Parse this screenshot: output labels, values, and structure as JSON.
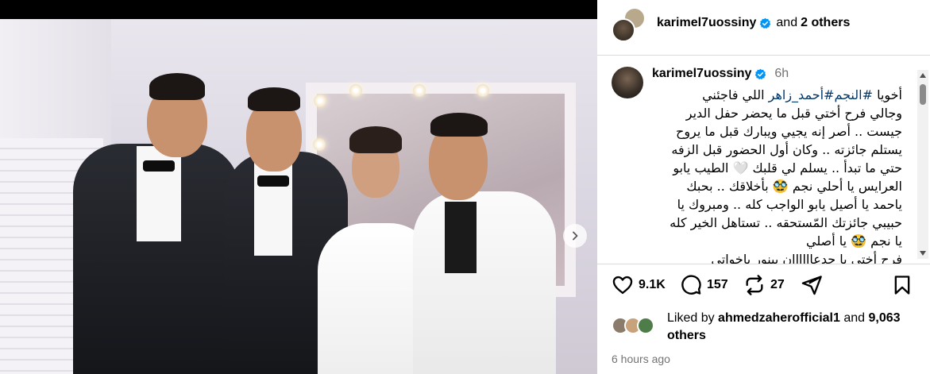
{
  "header": {
    "username": "karimel7uossiny",
    "and_text": "and",
    "others_text": "2 others"
  },
  "caption": {
    "username": "karimel7uossiny",
    "time": "6h",
    "hashtag1": "#النجم",
    "hashtag2": "#أحمد_زاهر",
    "lines": [
      "وجالي فرح أختي قبل ما يحضر حفل الدير",
      "جيست .. أصر إنه يجيي ويبارك قبل ما يروح",
      "يستلم جائزته .. وكان أول الحضور قبل الزفه",
      "حتي ما تبدأ .. يسلم لي قلبك 🤍 الطيب يابو",
      "العرايس يا أحلي نجم 🥸 بأخلاقك .. بحبك",
      "ياحمد يا أصيل يابو الواجب كله .. ومبروك يا",
      "حبيبي جائزتك المّستحقه .. تستاهل الخير كله",
      "يا نجم 🥸 يا أصلي",
      "فرح أختي يا جدعاااااان بينور بإخواتي"
    ],
    "first_line_prefix": "أخويا",
    "first_line_suffix": "اللي فاجئني"
  },
  "actions": {
    "likes": "9.1K",
    "comments": "157",
    "reposts": "27"
  },
  "liked_by": {
    "prefix": "Liked by",
    "user": "ahmedzaherofficial1",
    "and_text": "and",
    "count": "9,063",
    "suffix": "others"
  },
  "timestamp": "6 hours ago",
  "colors": {
    "verified": "#0095f6",
    "hashtag": "#00376b",
    "muted": "#737373"
  }
}
